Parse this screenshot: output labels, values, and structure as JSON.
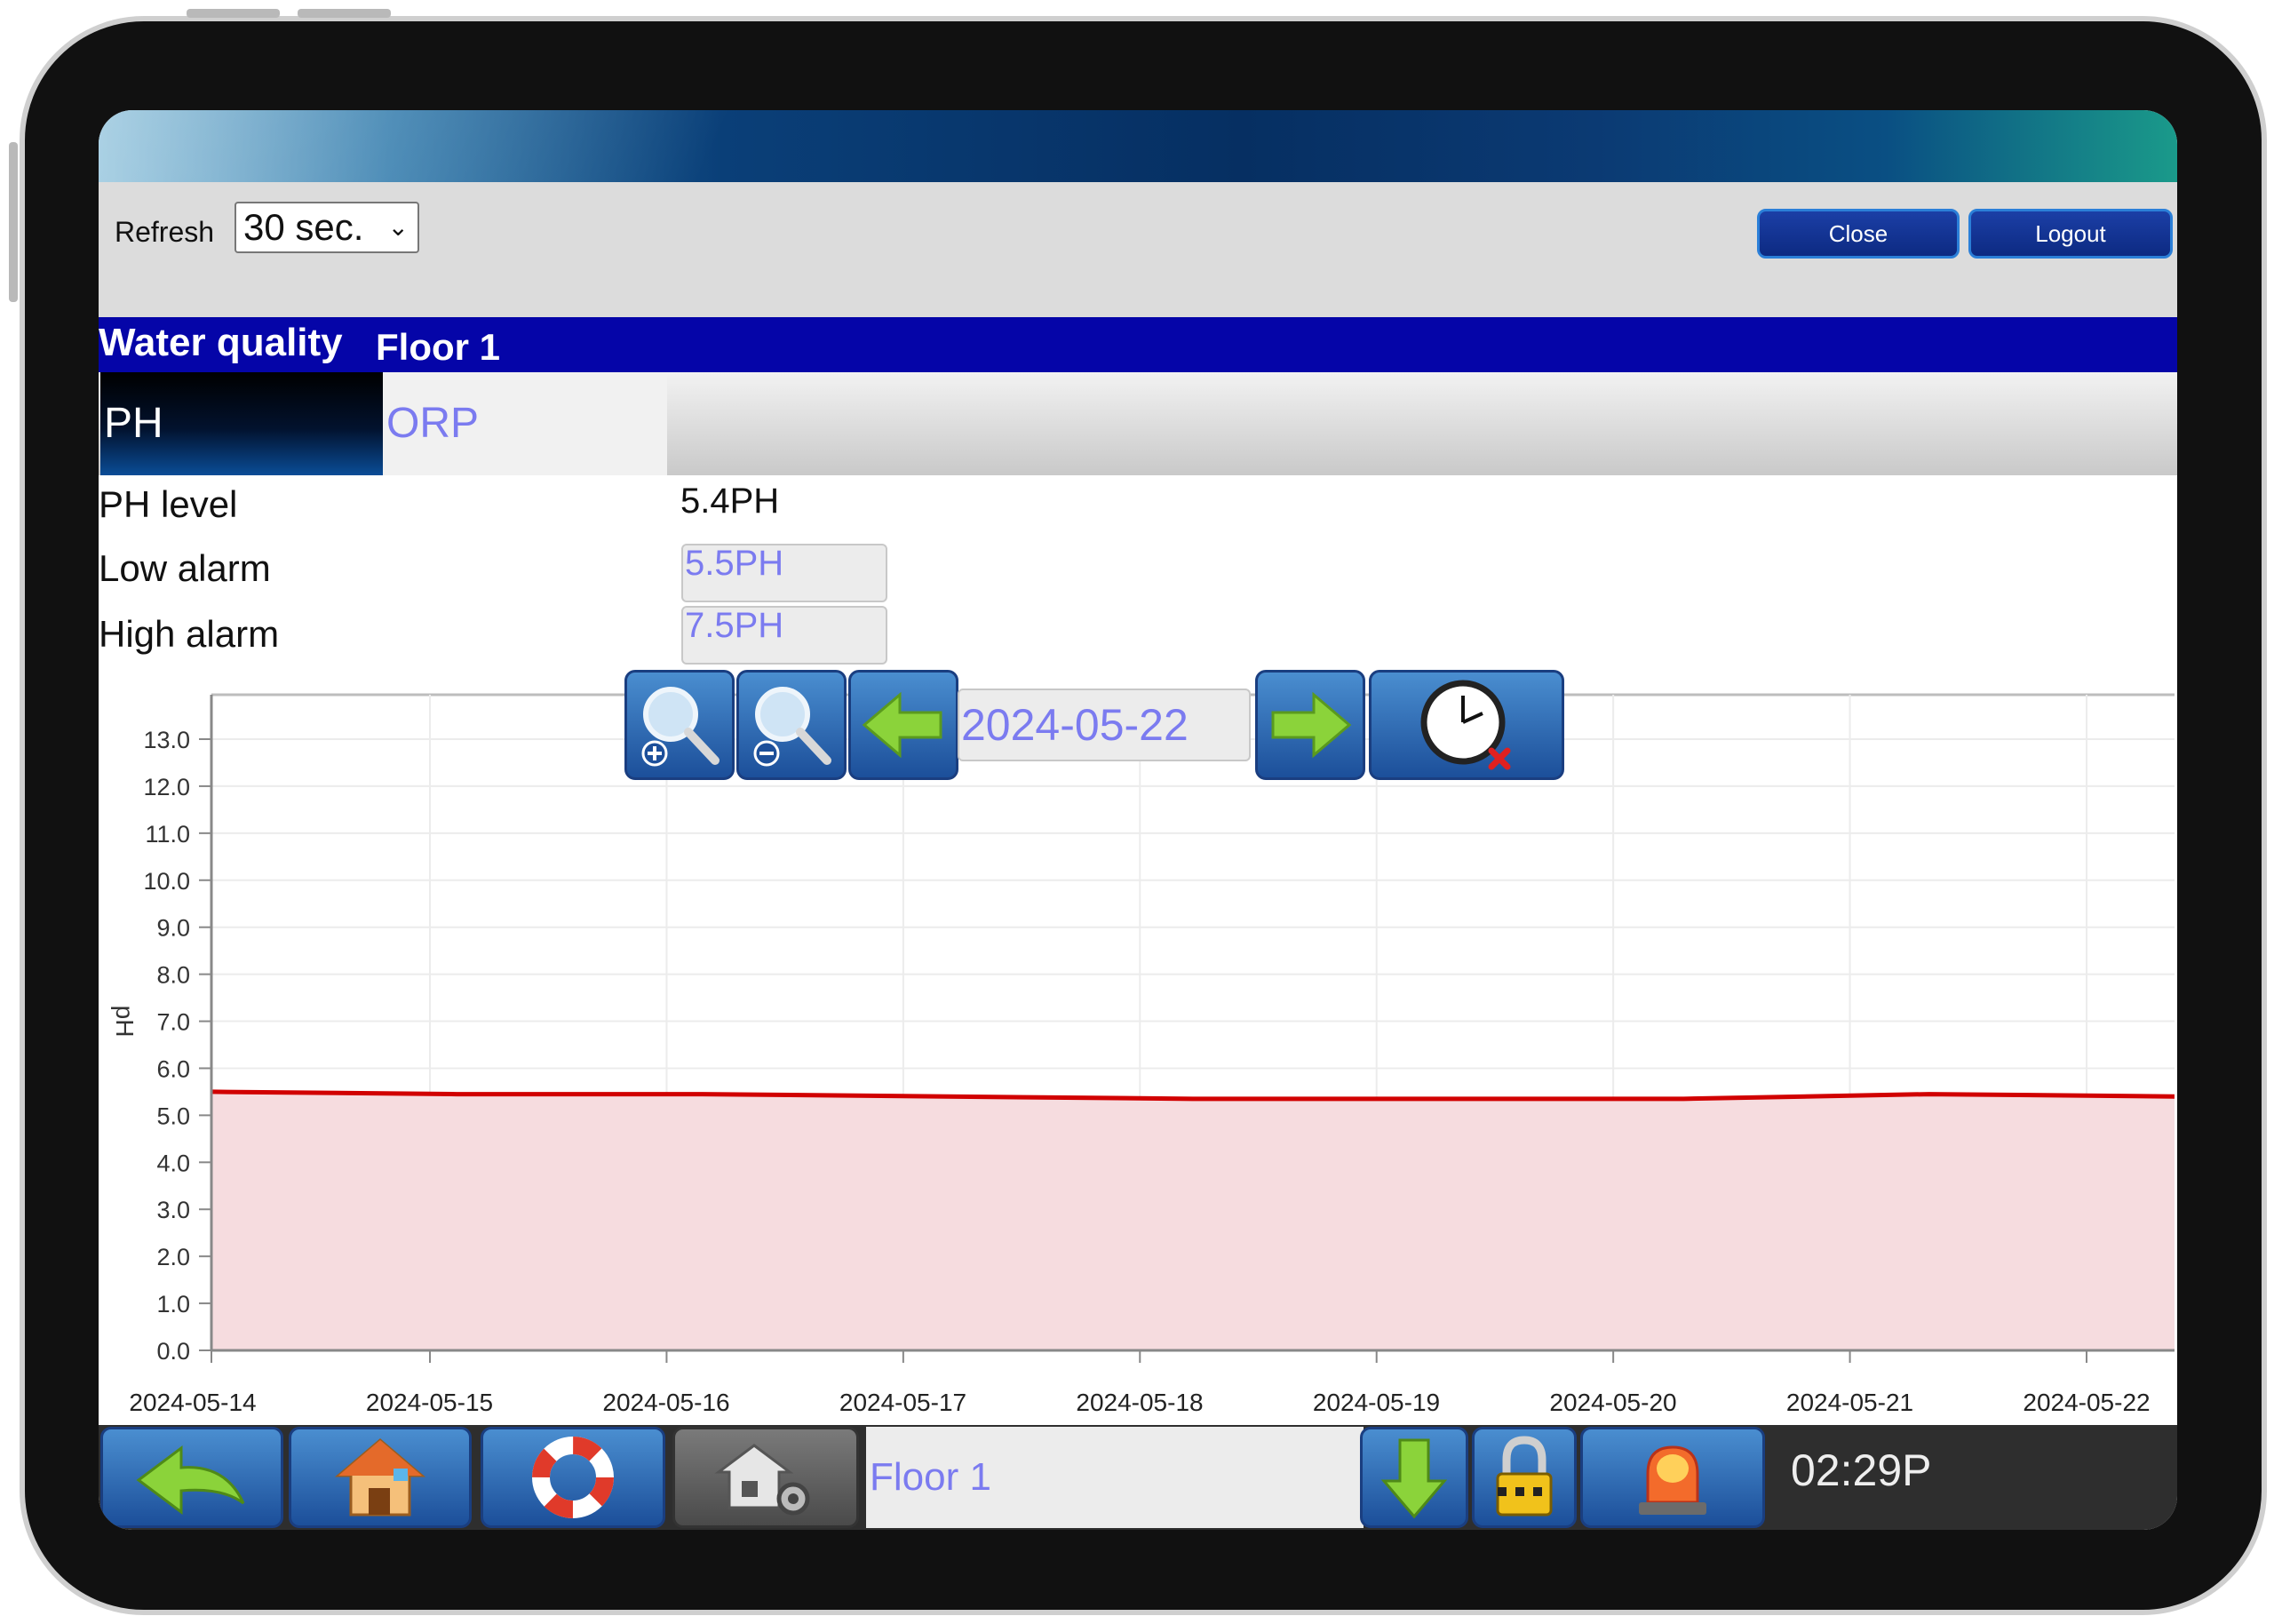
{
  "toolbar": {
    "refresh_label": "Refresh",
    "refresh_value": "30 sec.",
    "close_label": "Close",
    "logout_label": "Logout"
  },
  "title": {
    "section": "Water quality",
    "location": "Floor 1"
  },
  "tabs": [
    {
      "label": "PH",
      "active": true
    },
    {
      "label": "ORP",
      "active": false
    }
  ],
  "readings": {
    "ph_level_label": "PH level",
    "ph_level_value": "5.4PH",
    "low_alarm_label": "Low alarm",
    "low_alarm_value": "5.5PH",
    "high_alarm_label": "High alarm",
    "high_alarm_value": "7.5PH"
  },
  "chart_nav": {
    "date": "2024-05-22"
  },
  "bottom_bar": {
    "floor_label": "Floor 1",
    "time": "02:29P"
  },
  "colors": {
    "title_bar": "#0505a8",
    "accent_text": "#7b7bf0",
    "series_line": "#d10000",
    "series_fill": "#f6dcdf"
  },
  "chart_data": {
    "type": "area",
    "x": [
      "2024-05-14",
      "2024-05-15",
      "2024-05-16",
      "2024-05-17",
      "2024-05-18",
      "2024-05-19",
      "2024-05-20",
      "2024-05-21",
      "2024-05-22"
    ],
    "y": [
      5.5,
      5.45,
      5.45,
      5.4,
      5.35,
      5.35,
      5.35,
      5.45,
      5.4
    ],
    "ylabel": "pH",
    "yticks": [
      "0.0",
      "1.0",
      "2.0",
      "3.0",
      "4.0",
      "5.0",
      "6.0",
      "7.0",
      "8.0",
      "9.0",
      "10.0",
      "11.0",
      "12.0",
      "13.0"
    ],
    "ylim": [
      0,
      13.0
    ],
    "grid": true
  }
}
